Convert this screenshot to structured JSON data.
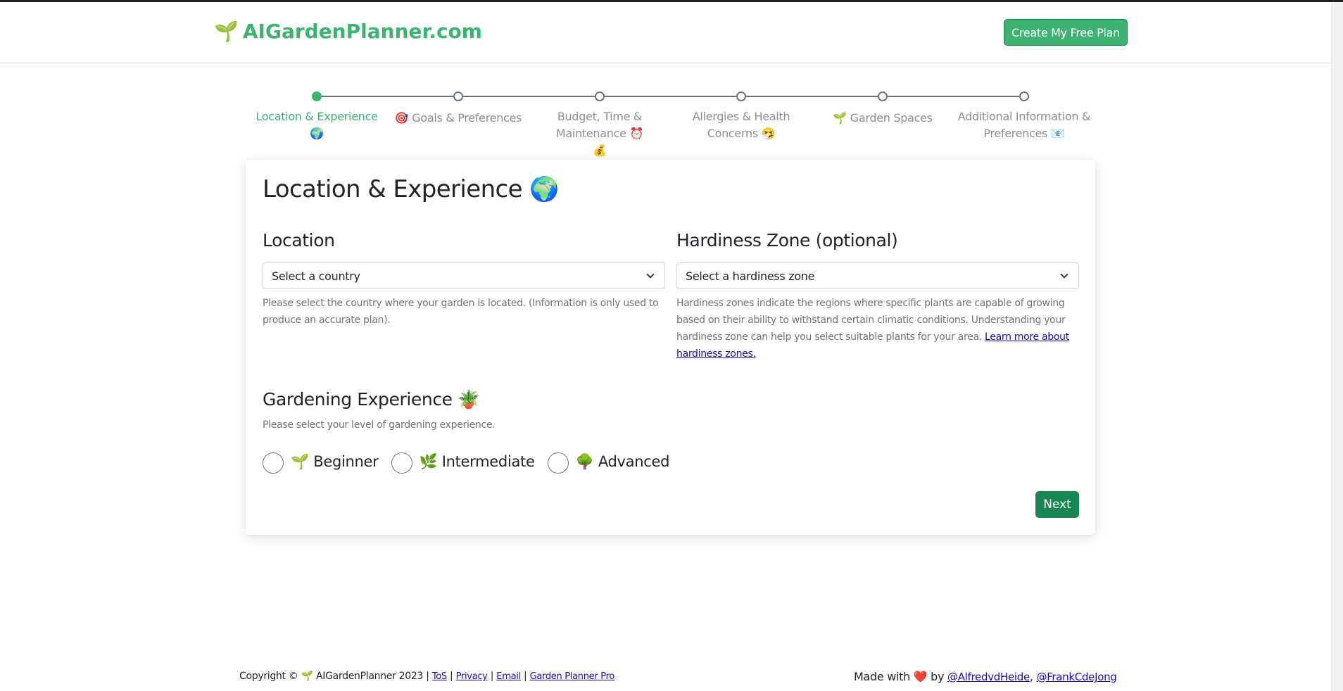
{
  "header": {
    "brand_icon": "🌱",
    "brand_name": "AIGardenPlanner.com",
    "cta_label": "Create My Free Plan",
    "brand_color": "#3cb371"
  },
  "stepper": {
    "steps": [
      {
        "label": "Location & Experience 🌍",
        "active": true
      },
      {
        "label": "🎯 Goals & Preferences",
        "active": false
      },
      {
        "label": "Budget, Time & Maintenance ⏰💰",
        "active": false
      },
      {
        "label": "Allergies & Health Concerns 🤧",
        "active": false
      },
      {
        "label": "🌱 Garden Spaces",
        "active": false
      },
      {
        "label": "Additional Information & Preferences 📧",
        "active": false
      }
    ]
  },
  "form": {
    "title": "Location & Experience 🌍",
    "location": {
      "heading": "Location",
      "select_value": "Select a country",
      "help": "Please select the country where your garden is located. (Information is only used to produce an accurate plan)."
    },
    "hardiness": {
      "heading": "Hardiness Zone (optional)",
      "select_value": "Select a hardiness zone",
      "help": "Hardiness zones indicate the regions where specific plants are capable of growing based on their ability to withstand certain climatic conditions. Understanding your hardiness zone can help you select suitable plants for your area.",
      "link": "Learn more about hardiness zones."
    },
    "experience": {
      "heading": "Gardening Experience 🪴",
      "help": "Please select your level of gardening experience.",
      "options": [
        "🌱 Beginner",
        "🌿 Intermediate",
        "🌳 Advanced"
      ]
    },
    "next_label": "Next"
  },
  "footer": {
    "copyright": "Copyright © 🌱 AIGardenPlanner 2023 |",
    "links": [
      "ToS",
      "Privacy",
      "Email",
      "Garden Planner Pro"
    ],
    "made_with": "Made with",
    "heart": "❤️",
    "by": "by",
    "authors": [
      "@AlfredvdHeide",
      "@FrankCdeJong"
    ]
  }
}
